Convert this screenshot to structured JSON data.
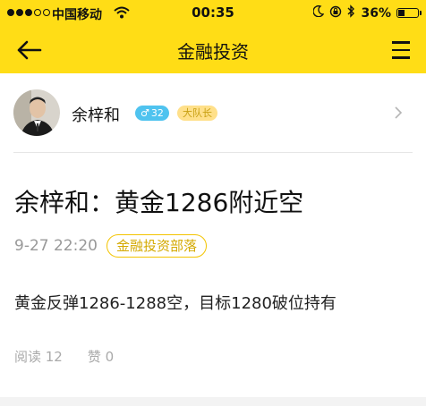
{
  "status_bar": {
    "carrier": "中国移动",
    "time": "00:35",
    "battery_text": "36%",
    "battery_level": 0.36,
    "icons": [
      "signal-dots-icon",
      "wifi-icon",
      "moon-icon",
      "lock-rotation-icon",
      "bluetooth-icon",
      "battery-icon"
    ]
  },
  "nav": {
    "title": "金融投资",
    "back_icon": "arrow-left-icon",
    "menu_icon": "hamburger-menu-icon"
  },
  "author": {
    "name": "余梓和",
    "gender_symbol": "♂",
    "age": "32",
    "rank": "大队长",
    "chevron_icon": "chevron-right-icon"
  },
  "post": {
    "title": "余梓和：黄金1286附近空",
    "date": "9-27 22:20",
    "tribe": "金融投资部落",
    "body": "黄金反弹1286-1288空，目标1280破位持有",
    "read_label": "阅读 12",
    "like_label": "赞 0"
  },
  "colors": {
    "header_yellow": "#ffdd16",
    "gender_badge": "#4fc3ef",
    "rank_badge": "#ffe08a",
    "tribe_border": "#f3c400"
  }
}
